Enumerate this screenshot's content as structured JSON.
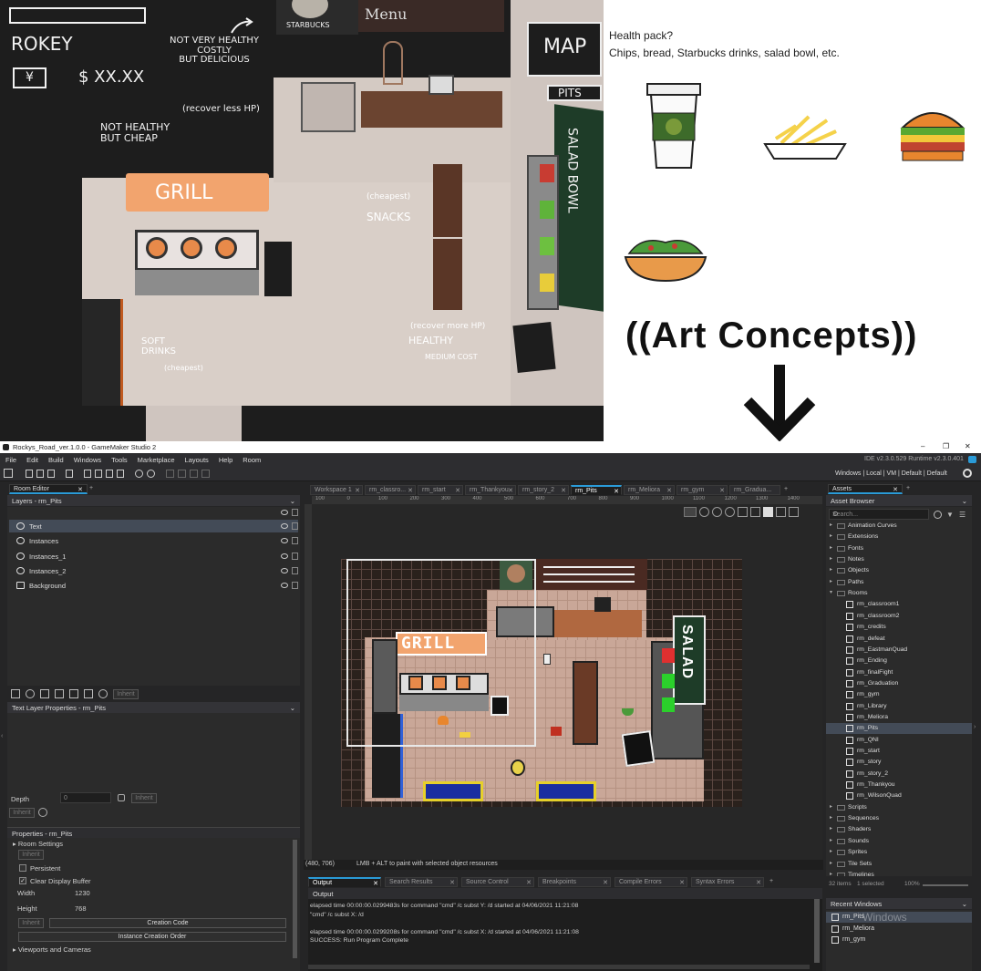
{
  "concept": {
    "hud_name": "ROKEY",
    "hud_money_icon": "¥",
    "hud_money": "$ XX.XX",
    "map_label": "MAP",
    "pits_label": "PITS",
    "starbucks": "STARBUCKS",
    "menu": "Menu",
    "note_starbucks": "NOT VERY HEALTHY\nCOSTLY\nBUT DELICIOUS",
    "note_recover_less": "(recover less HP)",
    "note_grill": "NOT HEALTHY\nBUT CHEAP",
    "grill": "GRILL",
    "note_snacks_cheap": "(cheapest)",
    "note_snacks": "SNACKS",
    "note_salad": "SALAD BOWL",
    "note_soft": "SOFT\nDRINKS",
    "note_soft_cheap": "(cheapest)",
    "note_recover_more": "(recover more HP)",
    "note_healthy": "HEALTHY",
    "note_medium": "MEDIUM COST",
    "health_title": "Health pack?",
    "health_list": "Chips, bread, Starbucks drinks, salad bowl, etc.",
    "art_concepts": "((Art Concepts))"
  },
  "window": {
    "title": "Rockys_Road_ver.1.0.0 - GameMaker Studio 2",
    "ide_version": "IDE v2.3.0.529  Runtime v2.3.0.401",
    "target": "Windows | Local | VM | Default | Default"
  },
  "menu": [
    "File",
    "Edit",
    "Build",
    "Windows",
    "Tools",
    "Marketplace",
    "Layouts",
    "Help",
    "Room"
  ],
  "room_editor": {
    "tab": "Room Editor",
    "layers_header": "Layers - rm_Pits",
    "layers": [
      "Text",
      "Instances",
      "Instances_1",
      "Instances_2",
      "Background"
    ],
    "inherit": "Inherit",
    "text_layer_header": "Text Layer Properties - rm_Pits",
    "depth_label": "Depth",
    "depth_value": "0",
    "properties_header": "Properties - rm_Pits",
    "room_settings": "Room Settings",
    "persistent": "Persistent",
    "clear_display": "Clear Display Buffer",
    "width_label": "Width",
    "width_value": "1230",
    "height_label": "Height",
    "height_value": "768",
    "creation_code": "Creation Code",
    "instance_order": "Instance Creation Order",
    "viewports": "Viewports and Cameras"
  },
  "editor_tabs": [
    "Workspace 1",
    "rm_classro...",
    "rm_start",
    "rm_Thankyou",
    "rm_story_2",
    "rm_Pits",
    "rm_Meliora",
    "rm_gym",
    "rm_Gradua..."
  ],
  "active_tab": "rm_Pits",
  "ruler": [
    "100",
    "0",
    "100",
    "200",
    "300",
    "400",
    "500",
    "600",
    "700",
    "800",
    "900",
    "1000",
    "1100",
    "1200",
    "1300",
    "1400"
  ],
  "room": {
    "grill_sign": "GRILL",
    "salad_sign": "SALAD"
  },
  "status": {
    "coords": "(480, 706)",
    "hint": "LMB + ALT to paint with selected object resources"
  },
  "output": {
    "tabs": [
      "Output",
      "Search Results",
      "Source Control",
      "Breakpoints",
      "Compile Errors",
      "Syntax Errors"
    ],
    "header": "Output",
    "lines": [
      "elapsed time 00:00:00.0299483s for command \"cmd\" /c subst Y: /d started at 04/06/2021 11:21:08",
      "\"cmd\"  /c subst X: /d",
      "",
      "elapsed time 00:00:00.0299208s for command \"cmd\" /c subst X: /d started at 04/06/2021 11:21:08",
      "SUCCESS: Run Program Complete"
    ]
  },
  "assets": {
    "tab": "Assets",
    "browser": "Asset Browser",
    "search_placeholder": "Search...",
    "tree": [
      {
        "label": "Animation Curves",
        "type": "folder",
        "indent": 0
      },
      {
        "label": "Extensions",
        "type": "folder",
        "indent": 0
      },
      {
        "label": "Fonts",
        "type": "folder",
        "indent": 0
      },
      {
        "label": "Notes",
        "type": "folder",
        "indent": 0
      },
      {
        "label": "Objects",
        "type": "folder",
        "indent": 0
      },
      {
        "label": "Paths",
        "type": "folder",
        "indent": 0
      },
      {
        "label": "Rooms",
        "type": "folder-open",
        "indent": 0
      },
      {
        "label": "rm_classroom1",
        "type": "room",
        "indent": 1
      },
      {
        "label": "rm_classroom2",
        "type": "room",
        "indent": 1
      },
      {
        "label": "rm_credits",
        "type": "room",
        "indent": 1
      },
      {
        "label": "rm_defeat",
        "type": "room",
        "indent": 1
      },
      {
        "label": "rm_EastmanQuad",
        "type": "room",
        "indent": 1
      },
      {
        "label": "rm_Ending",
        "type": "room",
        "indent": 1
      },
      {
        "label": "rm_finalFight",
        "type": "room",
        "indent": 1
      },
      {
        "label": "rm_Graduation",
        "type": "room",
        "indent": 1
      },
      {
        "label": "rm_gym",
        "type": "room",
        "indent": 1
      },
      {
        "label": "rm_Library",
        "type": "room",
        "indent": 1
      },
      {
        "label": "rm_Meliora",
        "type": "room",
        "indent": 1
      },
      {
        "label": "rm_Pits",
        "type": "room",
        "indent": 1,
        "selected": true
      },
      {
        "label": "rm_QNI",
        "type": "room",
        "indent": 1
      },
      {
        "label": "rm_start",
        "type": "room",
        "indent": 1
      },
      {
        "label": "rm_story",
        "type": "room",
        "indent": 1
      },
      {
        "label": "rm_story_2",
        "type": "room",
        "indent": 1
      },
      {
        "label": "rm_Thankyou",
        "type": "room",
        "indent": 1
      },
      {
        "label": "rm_WilsonQuad",
        "type": "room",
        "indent": 1
      },
      {
        "label": "Scripts",
        "type": "folder",
        "indent": 0
      },
      {
        "label": "Sequences",
        "type": "folder",
        "indent": 0
      },
      {
        "label": "Shaders",
        "type": "folder",
        "indent": 0
      },
      {
        "label": "Sounds",
        "type": "folder",
        "indent": 0
      },
      {
        "label": "Sprites",
        "type": "folder",
        "indent": 0
      },
      {
        "label": "Tile Sets",
        "type": "folder",
        "indent": 0
      },
      {
        "label": "Timelines",
        "type": "folder",
        "indent": 0
      }
    ],
    "footer_items": "32 items",
    "footer_selected": "1 selected",
    "zoom": "100%",
    "recent_header": "Recent Windows",
    "recent": [
      "rm_Pits",
      "rm_Meliora",
      "rm_gym"
    ],
    "watermark": "Windows"
  }
}
